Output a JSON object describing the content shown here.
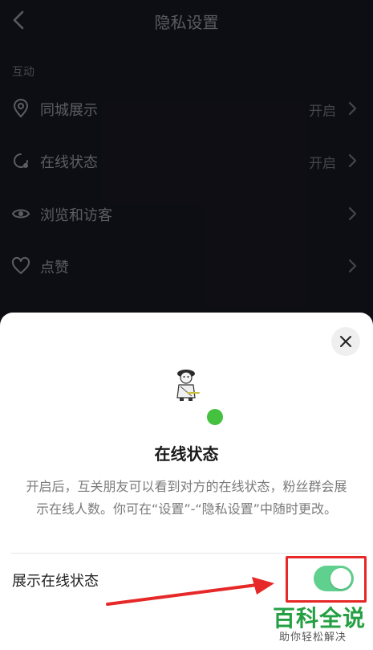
{
  "header": {
    "title": "隐私设置"
  },
  "section": {
    "label": "互动"
  },
  "rows": [
    {
      "label": "同城展示",
      "value": "开启",
      "icon": "location-pin-icon"
    },
    {
      "label": "在线状态",
      "value": "开启",
      "icon": "online-status-icon"
    },
    {
      "label": "浏览和访客",
      "value": "",
      "icon": "eye-icon"
    },
    {
      "label": "点赞",
      "value": "",
      "icon": "heart-icon"
    }
  ],
  "sheet": {
    "title": "在线状态",
    "description": "开启后，互关朋友可以看到对方的在线状态，粉丝群会展示在线人数。你可在“设置”-“隐私设置”中随时更改。",
    "toggle_label": "展示在线状态",
    "toggle_on": true,
    "online_dot_color": "#43c13f",
    "toggle_color": "#5fd08d"
  },
  "watermark": {
    "title": "百科全说",
    "subtitle": "助你轻松解决"
  }
}
